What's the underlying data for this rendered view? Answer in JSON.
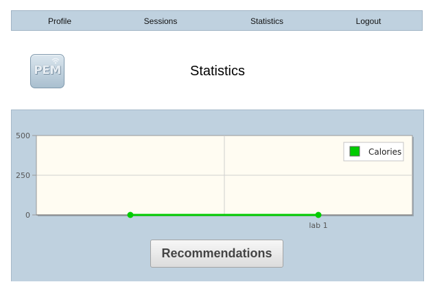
{
  "nav": {
    "items": [
      {
        "label": "Profile"
      },
      {
        "label": "Sessions"
      },
      {
        "label": "Statistics"
      },
      {
        "label": "Logout"
      }
    ]
  },
  "logo": {
    "text": "PEM",
    "icon": "wifi-signal-icon"
  },
  "page": {
    "title": "Statistics"
  },
  "chart_data": {
    "type": "line",
    "x_labels": [
      "",
      "lab 1"
    ],
    "series": [
      {
        "name": "Calories",
        "values": [
          0,
          0
        ],
        "color": "#00cc00"
      }
    ],
    "ylim": [
      0,
      500
    ],
    "yticks": [
      0,
      250,
      500
    ],
    "grid": true,
    "legend": "top-right",
    "background": "#fffcf2"
  },
  "actions": {
    "recommendations_label": "Recommendations"
  }
}
